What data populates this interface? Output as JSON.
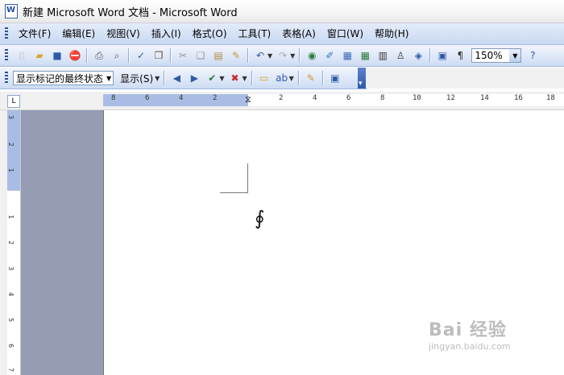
{
  "window": {
    "title": "新建 Microsoft Word 文档 - Microsoft Word"
  },
  "menu": [
    "文件(F)",
    "编辑(E)",
    "视图(V)",
    "插入(I)",
    "格式(O)",
    "工具(T)",
    "表格(A)",
    "窗口(W)",
    "帮助(H)"
  ],
  "toolbar": {
    "zoom": "150%"
  },
  "review": {
    "status": "显示标记的最终状态",
    "show_label": "显示(S)"
  },
  "ruler": {
    "h_ticks": [
      "8",
      "6",
      "4",
      "2",
      "2",
      "2",
      "4",
      "6",
      "8",
      "10",
      "12",
      "14",
      "16",
      "18"
    ],
    "v_ticks": [
      "3",
      "2",
      "1",
      "1",
      "2",
      "3",
      "4",
      "5",
      "6",
      "7"
    ],
    "corner": "L"
  },
  "document": {
    "symbol": "∮"
  },
  "watermark": {
    "brand": "Bai 经验",
    "url": "jingyan.baidu.com"
  },
  "colors": {
    "menubar": "#c9d8f1",
    "doc_background": "#959cb4",
    "ruler_margin": "#a9bde4"
  }
}
